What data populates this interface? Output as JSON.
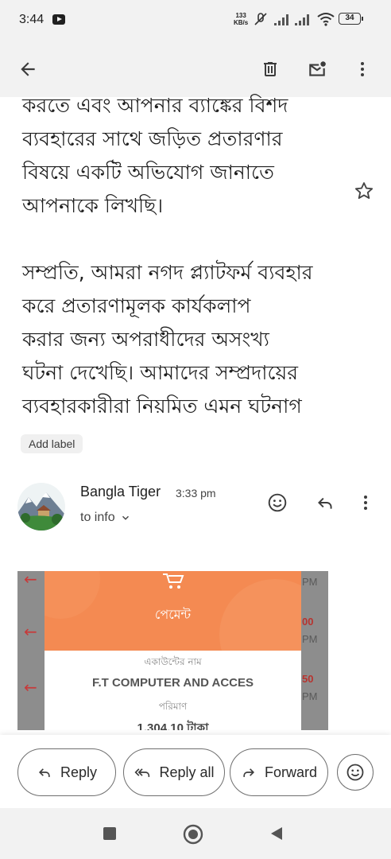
{
  "status_bar": {
    "time": "3:44",
    "net_speed_value": "133",
    "net_speed_unit": "KB/s",
    "battery": "34",
    "icons": [
      "youtube-icon",
      "mute-icon",
      "signal-icon",
      "signal-icon",
      "wifi-icon",
      "battery-icon"
    ]
  },
  "toolbar": {
    "icons": [
      "back-arrow-icon",
      "delete-icon",
      "mark-unread-icon",
      "more-vert-icon"
    ]
  },
  "message_body": {
    "paragraph1_lines": [
      "করতে এবং আপনার ব্যাঙ্কের বিশদ",
      "ব্যবহারের সাথে জড়িত প্রতারণার",
      "বিষয়ে একটি অভিযোগ জানাতে",
      "আপনাকে লিখছি।"
    ],
    "paragraph2_lines": [
      "সম্প্রতি, আমরা নগদ প্ল্যাটফর্ম ব্যবহার",
      "করে প্রতারণামূলক কার্যকলাপ",
      "করার জন্য অপরাধীদের অসংখ্য",
      "ঘটনা দেখেছি। আমাদের সম্প্রদায়ের",
      "ব্যবহারকারীরা নিয়মিত এমন ঘটনাগ"
    ]
  },
  "label_chip": "Add label",
  "reply_message": {
    "sender": "Bangla Tiger",
    "time": "3:33 pm",
    "to": "to info"
  },
  "attachment": {
    "title": "পেমেন্ট",
    "account_label": "একাউন্টের নাম",
    "account_name": "F.T COMPUTER AND ACCES",
    "amount_label": "পরিমাণ",
    "amount_value": "1,304.10 টাকা",
    "side_texts": [
      "PM",
      "00",
      "PM",
      "50",
      "PM"
    ]
  },
  "actions": {
    "reply": "Reply",
    "reply_all": "Reply all",
    "forward": "Forward"
  },
  "colors": {
    "payment_orange": "#f48a52",
    "system_bar": "#f2f2f2"
  }
}
